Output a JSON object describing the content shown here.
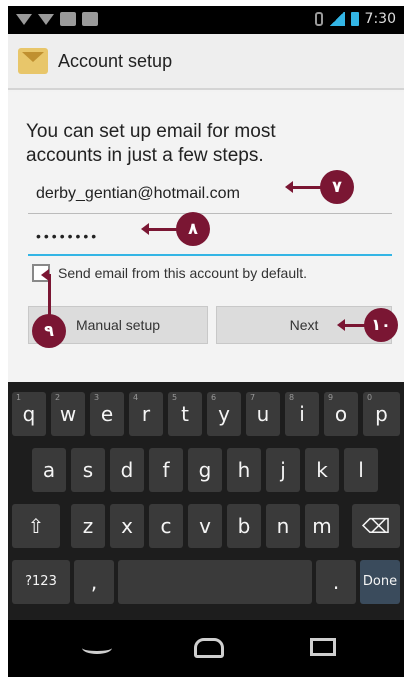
{
  "status_bar": {
    "time": "7:30"
  },
  "action_bar": {
    "title": "Account setup"
  },
  "form": {
    "intro": "You can set up email for most accounts in just a few steps.",
    "email_value": "derby_gentian@hotmail.com",
    "password_value": "••••••••",
    "default_checkbox_label": "Send email from this account by default.",
    "default_checked": false,
    "manual_setup_label": "Manual setup",
    "next_label": "Next"
  },
  "callouts": {
    "email": "٧",
    "password": "٨",
    "checkbox": "٩",
    "next": "١٠"
  },
  "keyboard": {
    "row1": [
      "q",
      "w",
      "e",
      "r",
      "t",
      "y",
      "u",
      "i",
      "o",
      "p"
    ],
    "row1_nums": [
      "1",
      "2",
      "3",
      "4",
      "5",
      "6",
      "7",
      "8",
      "9",
      "0"
    ],
    "row2": [
      "a",
      "s",
      "d",
      "f",
      "g",
      "h",
      "j",
      "k",
      "l"
    ],
    "row3": [
      "z",
      "x",
      "c",
      "v",
      "b",
      "n",
      "m"
    ],
    "shift": "⇧",
    "delete": "⌫",
    "sym": "?123",
    "comma": ",",
    "period": ".",
    "done": "Done"
  },
  "colors": {
    "callout": "#7a1633",
    "accent": "#33b5e5"
  }
}
